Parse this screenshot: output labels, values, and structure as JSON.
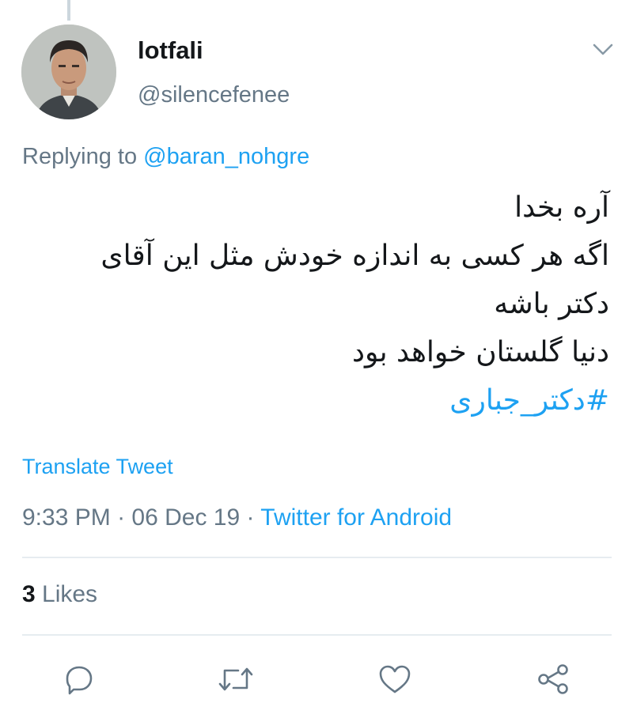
{
  "tweet": {
    "display_name": "lotfali",
    "handle": "@silencefenee",
    "replying_prefix": "Replying to",
    "replying_to": "@baran_nohgre",
    "text_lines": [
      "آره بخدا",
      "اگه هر کسی به اندازه خودش مثل این آقای",
      "دکتر باشه",
      "دنیا گلستان خواهد بود"
    ],
    "hashtag": "#دکتر_جباری",
    "translate_label": "Translate Tweet",
    "time": "9:33 PM",
    "date": "06 Dec 19",
    "separator": " · ",
    "source": "Twitter for Android",
    "likes_count": "3",
    "likes_label": " Likes"
  },
  "icons": {
    "chevron": "chevron-down-icon",
    "reply": "reply-icon",
    "retweet": "retweet-icon",
    "like": "heart-icon",
    "share": "share-icon"
  },
  "colors": {
    "accent": "#1da1f2",
    "secondary_text": "#657786",
    "primary_text": "#14171a",
    "divider": "#e6ecf0"
  }
}
